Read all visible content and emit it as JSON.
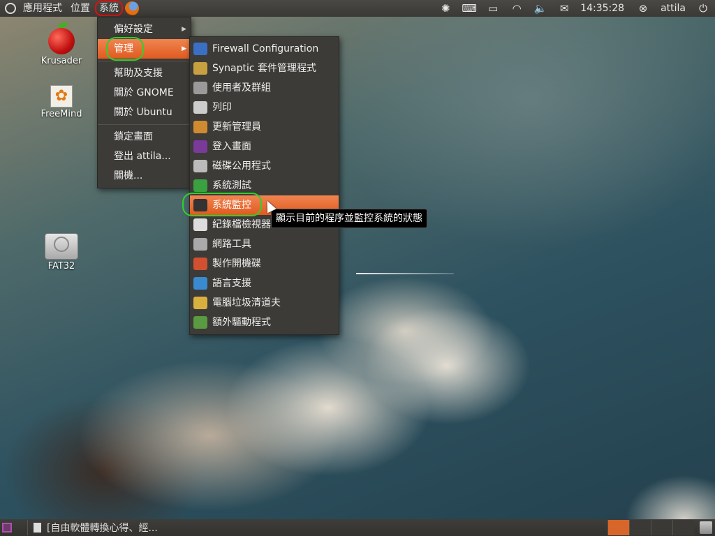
{
  "top_panel": {
    "applications_menu": "應用程式",
    "places_menu": "位置",
    "system_menu": "系統",
    "clock": "14:35:28",
    "user": "attila"
  },
  "desktop_icons": {
    "krusader": "Krusader",
    "freemind": "FreeMind",
    "fat32": "FAT32"
  },
  "system_menu": {
    "items": [
      {
        "label": "偏好設定"
      },
      {
        "label": "管理"
      },
      {
        "label": "幫助及支援"
      },
      {
        "label": "關於 GNOME"
      },
      {
        "label": "關於 Ubuntu"
      },
      {
        "label": "鎖定畫面"
      },
      {
        "label": "登出 attila..."
      },
      {
        "label": "關機..."
      }
    ]
  },
  "admin_menu": {
    "items": [
      {
        "label": "Firewall Configuration",
        "icon": "shield-icon",
        "color": "#3a6fc4"
      },
      {
        "label": "Synaptic 套件管理程式",
        "icon": "package-icon",
        "color": "#c8a040"
      },
      {
        "label": "使用者及群組",
        "icon": "users-icon",
        "color": "#9a9a9a"
      },
      {
        "label": "列印",
        "icon": "printer-icon",
        "color": "#cccccc"
      },
      {
        "label": "更新管理員",
        "icon": "update-icon",
        "color": "#d08a30"
      },
      {
        "label": "登入畫面",
        "icon": "login-screen-icon",
        "color": "#7a3a9a"
      },
      {
        "label": "磁碟公用程式",
        "icon": "disk-icon",
        "color": "#bbbbbb"
      },
      {
        "label": "系統測試",
        "icon": "checkbox-icon",
        "color": "#3aa040"
      },
      {
        "label": "系統監控",
        "icon": "monitor-icon",
        "color": "#333333"
      },
      {
        "label": "紀錄檔檢視器",
        "icon": "log-icon",
        "color": "#dddddd"
      },
      {
        "label": "網路工具",
        "icon": "network-icon",
        "color": "#aaaaaa"
      },
      {
        "label": "製作開機碟",
        "icon": "startup-disk-icon",
        "color": "#d05030"
      },
      {
        "label": "語言支援",
        "icon": "language-icon",
        "color": "#3a8ad0"
      },
      {
        "label": "電腦垃圾清道夫",
        "icon": "broom-icon",
        "color": "#d8b040"
      },
      {
        "label": "額外驅動程式",
        "icon": "driver-icon",
        "color": "#5a9a40"
      }
    ]
  },
  "tooltip": "顯示目前的程序並監控系統的狀態",
  "bottom_panel": {
    "task_label": "[自由軟體轉換心得、經..."
  },
  "colors": {
    "menu_highlight": "#e8662a",
    "annotation_green": "#2ed12e",
    "annotation_red": "#e01010"
  }
}
